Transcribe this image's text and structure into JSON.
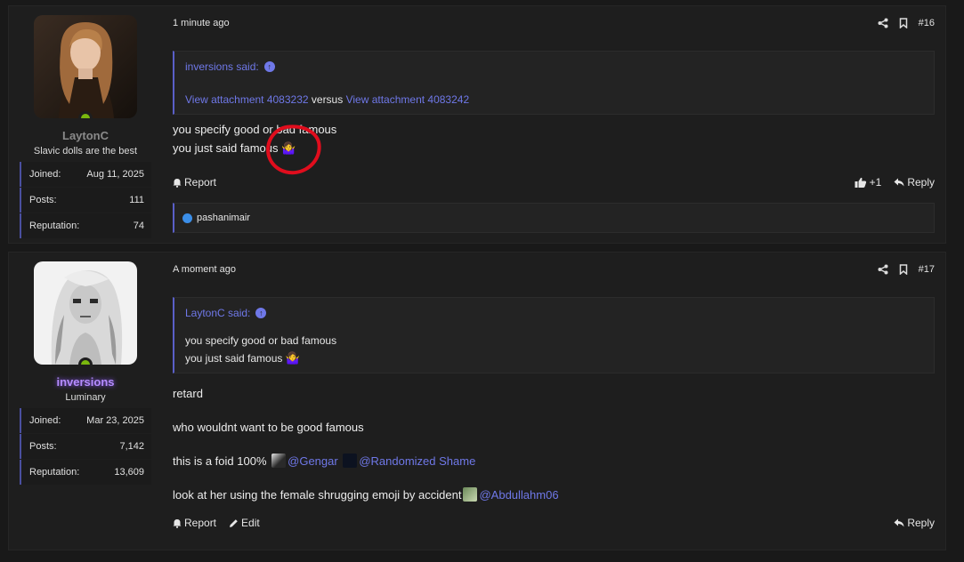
{
  "posts": [
    {
      "user": {
        "name": "LaytonC",
        "title": "Slavic dolls are the best",
        "stats": [
          {
            "label": "Joined:",
            "value": "Aug 11, 2025"
          },
          {
            "label": "Posts:",
            "value": "111"
          },
          {
            "label": "Reputation:",
            "value": "74"
          }
        ]
      },
      "time": "1 minute ago",
      "number": "#16",
      "quote": {
        "author": "inversions said:",
        "line_parts": {
          "att1": "View attachment 4083232",
          "versus": "versus",
          "att2": "View attachment 4083242"
        }
      },
      "body": [
        "you specify good or bad famous",
        "you just said famous"
      ],
      "actions": {
        "report": "Report",
        "like_count": "+1",
        "reply": "Reply"
      },
      "reaction_user": "pashanimair"
    },
    {
      "user": {
        "name": "inversions",
        "title": "Luminary",
        "stats": [
          {
            "label": "Joined:",
            "value": "Mar 23, 2025"
          },
          {
            "label": "Posts:",
            "value": "7,142"
          },
          {
            "label": "Reputation:",
            "value": "13,609"
          }
        ]
      },
      "time": "A moment ago",
      "number": "#17",
      "quote": {
        "author": "LaytonC said:",
        "lines": [
          "you specify good or bad famous",
          "you just said famous"
        ]
      },
      "body": {
        "p1": "retard",
        "p2": "who wouldnt want to be good famous",
        "p3": "this is a foid 100%",
        "mention1": "@Gengar",
        "mention2": "@Randomized Shame",
        "p4": "look at her using the female shrugging emoji by accident",
        "mention3": "@Abdullahm06"
      },
      "actions": {
        "report": "Report",
        "edit": "Edit",
        "reply": "Reply"
      }
    }
  ],
  "icons": {
    "share": "share-icon",
    "bookmark": "bookmark-icon",
    "bell": "bell-icon",
    "thumbs_up": "thumbs-up-icon",
    "reply": "reply-arrow-icon",
    "pencil": "pencil-icon",
    "arrow_up": "arrow-up-circle-icon",
    "shrug": "🤷‍♀️"
  },
  "colors": {
    "link": "#6f78e8",
    "online": "#7ab80e",
    "annotation": "#e00d1d",
    "background": "#191919",
    "post": "#1e1e1e"
  }
}
